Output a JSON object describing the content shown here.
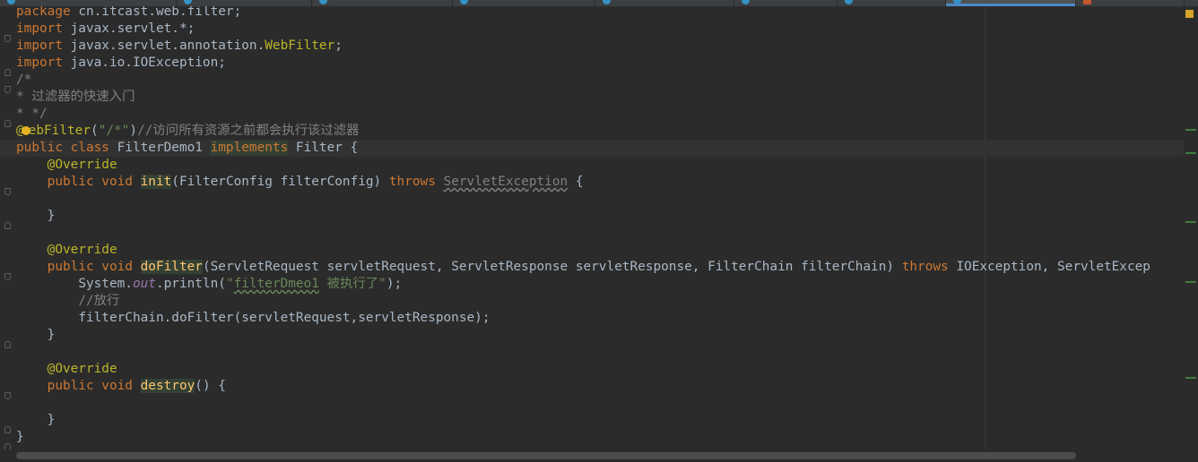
{
  "tabs": {
    "count": 9,
    "active_index": 8
  },
  "code": {
    "l1_pkg_kw": "package",
    "l1_pkg": " cn.itcast.web.filter;",
    "l2_kw": "import",
    "l2_rest": " javax.servlet.*;",
    "l3_kw": "import",
    "l3_pre": " javax.servlet.annotation.",
    "l3_cls": "WebFilter",
    "l3_semi": ";",
    "l4_kw": "import",
    "l4_rest": " java.io.IOException;",
    "l5": "/*",
    "l6": "* 过滤器的快速入门",
    "l7": "* */",
    "l8_at": "@",
    "l8_ann": "ebFilter",
    "l8_open": "(",
    "l8_str": "\"/*\"",
    "l8_close": ")",
    "l8_cmt": "//访问所有资源之前都会执行该过滤器",
    "l9_kw1": "public class",
    "l9_name": " FilterDemo1 ",
    "l9_impl": "implements",
    "l9_rest": " Filter {",
    "l10_ann": "@Override",
    "l11_kw": "public void",
    "l11_sp": " ",
    "l11_fn": "init",
    "l11_params": "(FilterConfig filterConfig) ",
    "l11_throws": "throws",
    "l11_sp2": " ",
    "l11_exc": "ServletException",
    "l11_brace": " {",
    "l13": "}",
    "l15_ann": "@Override",
    "l16_kw": "public void",
    "l16_sp": " ",
    "l16_fn": "doFilter",
    "l16_params": "(ServletRequest servletRequest, ServletResponse servletResponse, FilterChain filterChain) ",
    "l16_throws": "throws",
    "l16_rest": " IOException, ServletExcep",
    "l17_sys": "System.",
    "l17_out": "out",
    "l17_call": ".println(",
    "l17_str_a": "\"",
    "l17_str_b": "filterDmeo1",
    "l17_str_c": " 被执行了\"",
    "l17_end": ");",
    "l18": "//放行",
    "l19": "filterChain.doFilter(servletRequest,servletResponse);",
    "l20": "}",
    "l22_ann": "@Override",
    "l23_kw": "public void",
    "l23_sp": " ",
    "l23_fn": "destroy",
    "l23_rest": "() {",
    "l25": "}",
    "l26": "}"
  },
  "colors": {
    "background": "#2b2b2b",
    "text": "#a9b7c6",
    "keyword": "#cc7832",
    "annotation": "#bbb529",
    "string": "#6a8759",
    "comment": "#808080",
    "function": "#ffc66d",
    "static_field": "#9876aa"
  }
}
